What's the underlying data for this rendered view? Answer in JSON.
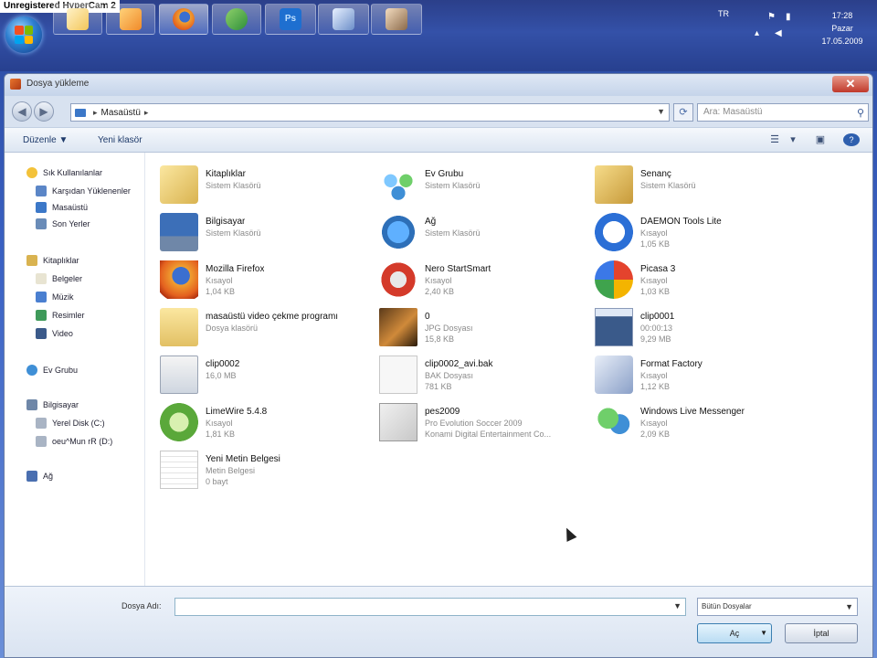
{
  "overlay": {
    "recorder_watermark": "Unregistered HyperCam 2"
  },
  "taskbar": {
    "buttons": [
      {
        "icon": "mail-icon",
        "color": "#f3c65a"
      },
      {
        "icon": "media-player-icon",
        "color": "#f08a2a"
      },
      {
        "icon": "firefox-icon",
        "color": "#e4611f"
      },
      {
        "icon": "messenger-icon",
        "color": "#4db04a"
      },
      {
        "icon": "photoshop-icon",
        "color": "#1e6fd0"
      },
      {
        "icon": "document-icon",
        "color": "#6c8fc9"
      },
      {
        "icon": "user-icon",
        "color": "#c9a27e"
      }
    ],
    "tray": {
      "language": "TR",
      "time": "17:28",
      "day": "Pazar",
      "date": "17.05.2009"
    }
  },
  "dialog": {
    "title": "Dosya yükleme",
    "address": {
      "location": "Masaüstü"
    },
    "search_placeholder": "Ara: Masaüstü",
    "toolbar": {
      "organize": "Düzenle ▼",
      "new_folder": "Yeni klasör"
    },
    "nav": {
      "favorites": {
        "header": "Sık Kullanılanlar",
        "items": [
          "Karşıdan Yüklenenler",
          "Masaüstü",
          "Son Yerler"
        ]
      },
      "libraries": {
        "header": "Kitaplıklar",
        "items": [
          "Belgeler",
          "Müzik",
          "Resimler",
          "Video"
        ]
      },
      "homegroup": "Ev Grubu",
      "computer": {
        "header": "Bilgisayar",
        "items": [
          "Yerel Disk (C:)",
          "oeu^Mun rR (D:)"
        ]
      },
      "network": "Ağ"
    },
    "files": [
      {
        "name": "Kitaplıklar",
        "line2": "Sistem Klasörü",
        "line3": "",
        "icon": "libraries-icon"
      },
      {
        "name": "Ev Grubu",
        "line2": "Sistem Klasörü",
        "line3": "",
        "icon": "homegroup-icon"
      },
      {
        "name": "Senanç",
        "line2": "Sistem Klasörü",
        "line3": "",
        "icon": "user-folder-icon"
      },
      {
        "name": "Bilgisayar",
        "line2": "Sistem Klasörü",
        "line3": "",
        "icon": "computer-icon"
      },
      {
        "name": "Ağ",
        "line2": "Sistem Klasörü",
        "line3": "",
        "icon": "network-icon"
      },
      {
        "name": "DAEMON Tools Lite",
        "line2": "Kısayol",
        "line3": "1,05 KB",
        "icon": "daemon-tools-icon"
      },
      {
        "name": "Mozilla Firefox",
        "line2": "Kısayol",
        "line3": "1,04 KB",
        "icon": "firefox-icon"
      },
      {
        "name": "Nero StartSmart",
        "line2": "Kısayol",
        "line3": "2,40 KB",
        "icon": "nero-icon"
      },
      {
        "name": "Picasa 3",
        "line2": "Kısayol",
        "line3": "1,03 KB",
        "icon": "picasa-icon"
      },
      {
        "name": "masaüstü video çekme programı",
        "line2": "Dosya klasörü",
        "line3": "",
        "icon": "folder-icon"
      },
      {
        "name": "0",
        "line2": "JPG Dosyası",
        "line3": "15,8 KB",
        "icon": "image-icon"
      },
      {
        "name": "clip0001",
        "line2": "00:00:13",
        "line3": "9,29 MB",
        "icon": "video-icon"
      },
      {
        "name": "clip0002",
        "line2": "16,0 MB",
        "line3": "",
        "icon": "video-file-icon"
      },
      {
        "name": "clip0002_avi.bak",
        "line2": "BAK Dosyası",
        "line3": "781 KB",
        "icon": "blank-file-icon"
      },
      {
        "name": "Format Factory",
        "line2": "Kısayol",
        "line3": "1,12 KB",
        "icon": "format-factory-icon"
      },
      {
        "name": "LimeWire 5.4.8",
        "line2": "Kısayol",
        "line3": "1,81 KB",
        "icon": "limewire-icon"
      },
      {
        "name": "pes2009",
        "line2": "Pro Evolution Soccer 2009",
        "line3": "Konami Digital Entertainment Co...",
        "icon": "pes-icon"
      },
      {
        "name": "Windows Live Messenger",
        "line2": "Kısayol",
        "line3": "2,09 KB",
        "icon": "messenger-icon"
      },
      {
        "name": "Yeni Metin Belgesi",
        "line2": "Metin Belgesi",
        "line3": "0 bayt",
        "icon": "text-file-icon"
      }
    ],
    "footer": {
      "filename_label": "Dosya Adı:",
      "filename_value": "",
      "filter": "Bütün Dosyalar",
      "open": "Aç",
      "cancel": "İptal"
    }
  }
}
